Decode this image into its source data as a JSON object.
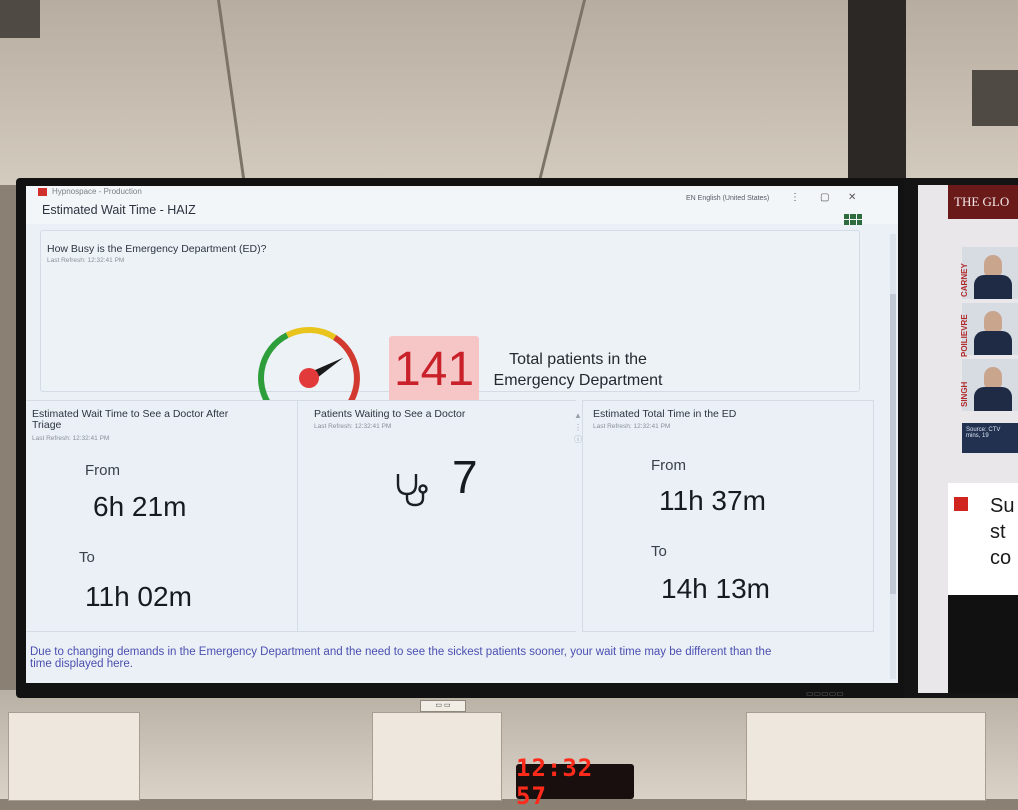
{
  "app": {
    "name": "Hypnospace - Production",
    "title": "Estimated Wait Time - HAIZ",
    "language": "EN English (United States)"
  },
  "busy": {
    "title": "How Busy is the Emergency Department (ED)?",
    "refresh": "Last Refresh: 12:32:41 PM",
    "total": "141",
    "total_label_1": "Total patients in the",
    "total_label_2": "Emergency Department",
    "gauge_level": 0.72
  },
  "doctor_wait": {
    "title_line1": "Estimated Wait Time to See a Doctor After",
    "title_line2": "Triage",
    "refresh": "Last Refresh: 12:32:41 PM",
    "from_label": "From",
    "from_value": "6h 21m",
    "to_label": "To",
    "to_value": "11h 02m"
  },
  "patients_waiting": {
    "title": "Patients Waiting to See a Doctor",
    "refresh": "Last Refresh: 12:32:41 PM",
    "value": "7"
  },
  "total_time": {
    "title": "Estimated Total Time in the ED",
    "refresh": "Last Refresh: 12:32:41 PM",
    "from_label": "From",
    "from_value": "11h 37m",
    "to_label": "To",
    "to_value": "14h 13m"
  },
  "footer": {
    "line1": "Due to changing demands in the Emergency Department and the need to see the sickest patients sooner, your wait time may be different than the",
    "line2": "time displayed here."
  },
  "wall_clock": "12:32 57",
  "tv2": {
    "header": "THE GLO",
    "candidates": [
      "CARNEY",
      "POILIEVRE",
      "SINGH"
    ],
    "source": "Source: CTV mins, 19",
    "ticker": [
      "Su",
      "st",
      "co"
    ]
  },
  "colors": {
    "gauge_green": "#2e9e3a",
    "gauge_yellow": "#e8c41c",
    "gauge_red": "#d23a2f",
    "count_bg": "#f6c6c6",
    "count_fg": "#c9212a"
  }
}
